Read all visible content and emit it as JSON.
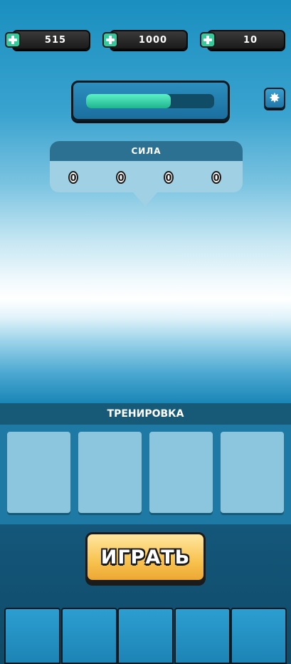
{
  "currencies": [
    {
      "value": "515",
      "icon": "plus-icon"
    },
    {
      "value": "1000",
      "icon": "plus-icon"
    },
    {
      "value": "10",
      "icon": "plus-icon"
    }
  ],
  "power_bar": {
    "fill_fraction": 0.66
  },
  "settings": {
    "icon": "gear-icon",
    "glyph": "✸"
  },
  "power_panel": {
    "title": "СИЛА",
    "stats": [
      "0",
      "0",
      "0",
      "0"
    ]
  },
  "training": {
    "title": "ТРЕНИРОВКА",
    "slots": [
      "",
      "",
      "",
      ""
    ]
  },
  "play_button": {
    "label": "ИГРАТЬ"
  },
  "bottom_nav": {
    "tabs": [
      "",
      "",
      "",
      "",
      ""
    ]
  },
  "colors": {
    "accent_green": "#35c99b",
    "button_yellow": "#f8c24e",
    "panel_blue": "#2d7192"
  }
}
